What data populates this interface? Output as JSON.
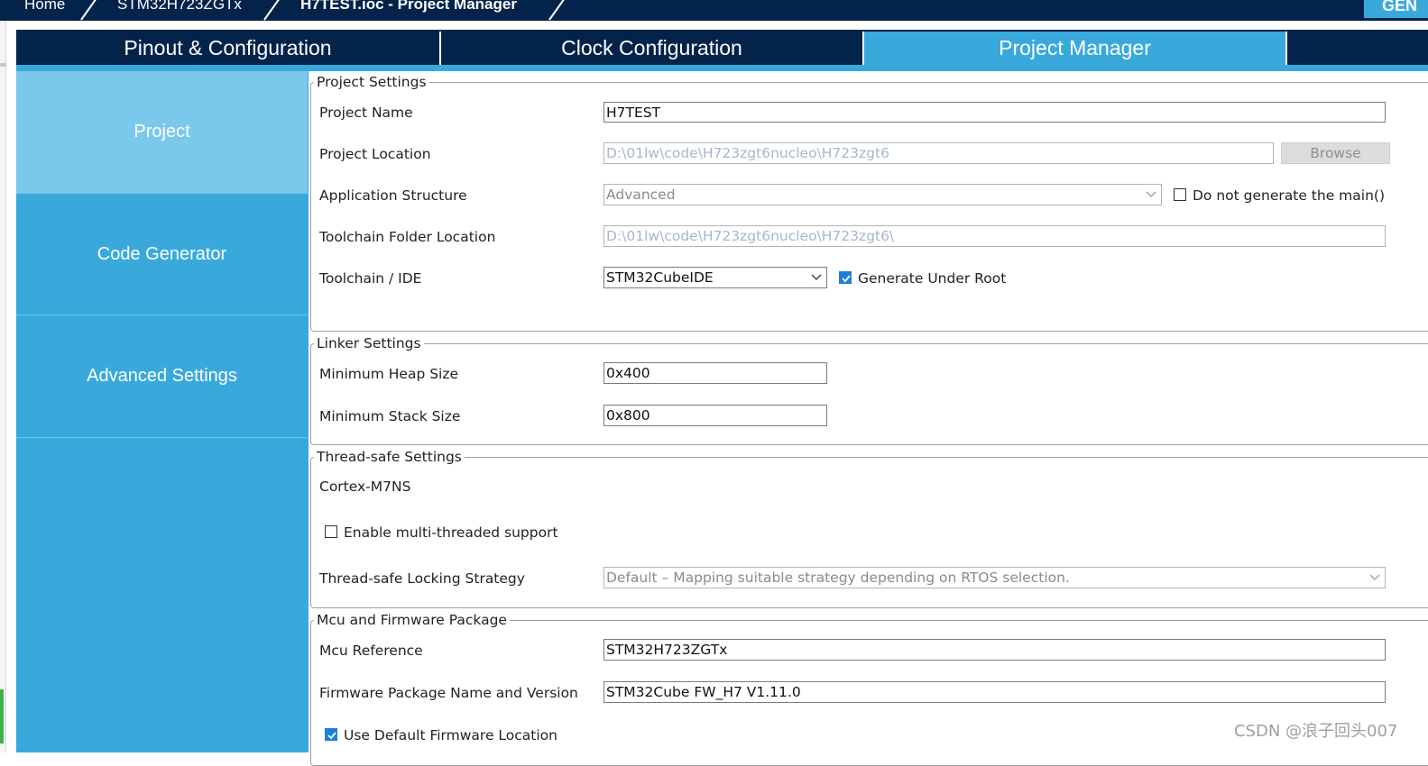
{
  "breadcrumb": {
    "items": [
      "Home",
      "STM32H723ZGTx",
      "H7TEST.ioc - Project Manager"
    ],
    "generate_label": "GEN"
  },
  "tabs": [
    {
      "label": "Pinout & Configuration",
      "active": false
    },
    {
      "label": "Clock Configuration",
      "active": false
    },
    {
      "label": "Project Manager",
      "active": true
    }
  ],
  "sidebar": {
    "items": [
      {
        "label": "Project",
        "active": true
      },
      {
        "label": "Code Generator",
        "active": false
      },
      {
        "label": "Advanced Settings",
        "active": false
      }
    ]
  },
  "project_settings": {
    "legend": "Project Settings",
    "project_name_label": "Project Name",
    "project_name_value": "H7TEST",
    "project_location_label": "Project Location",
    "project_location_value": "D:\\01lw\\code\\H723zgt6nucleo\\H723zgt6",
    "browse_label": "Browse",
    "app_structure_label": "Application Structure",
    "app_structure_value": "Advanced",
    "no_main_label": "Do not generate the main()",
    "no_main_checked": false,
    "toolchain_folder_label": "Toolchain Folder Location",
    "toolchain_folder_value": "D:\\01lw\\code\\H723zgt6nucleo\\H723zgt6\\",
    "toolchain_ide_label": "Toolchain / IDE",
    "toolchain_ide_value": "STM32CubeIDE",
    "gen_under_root_label": "Generate Under Root",
    "gen_under_root_checked": true
  },
  "linker_settings": {
    "legend": "Linker Settings",
    "heap_label": "Minimum Heap Size",
    "heap_value": "0x400",
    "stack_label": "Minimum Stack Size",
    "stack_value": "0x800"
  },
  "thread_safe": {
    "legend": "Thread-safe Settings",
    "core_label": "Cortex-M7NS",
    "multithread_label": "Enable multi-threaded support",
    "multithread_checked": false,
    "locking_label": "Thread-safe Locking Strategy",
    "locking_value": "Default  –  Mapping suitable strategy depending on RTOS selection."
  },
  "mcu_firmware": {
    "legend": "Mcu and Firmware Package",
    "mcu_ref_label": "Mcu Reference",
    "mcu_ref_value": "STM32H723ZGTx",
    "fw_label": "Firmware Package Name and Version",
    "fw_value": "STM32Cube FW_H7 V1.11.0",
    "use_default_label": "Use Default Firmware Location",
    "use_default_checked": true
  },
  "watermark": "CSDN @浪子回头007",
  "colors": {
    "navy": "#03234b",
    "accent": "#39a9dc",
    "active_sidebar": "#7ac8ec",
    "checkbox": "#1f7fd6"
  }
}
